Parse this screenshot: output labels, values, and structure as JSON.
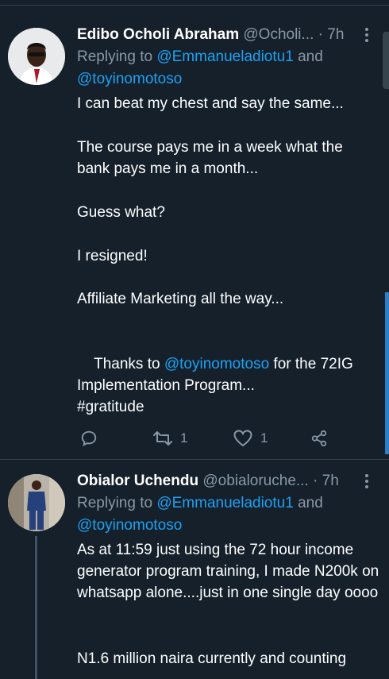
{
  "tweets": [
    {
      "name": "Edibo Ocholi Abraham",
      "handle": "@Ocholi...",
      "dot": "·",
      "time": "7h",
      "replying_prefix": "Replying to ",
      "reply_mention_1": "@Emmanueladiotu1",
      "reply_and": " and",
      "reply_mention_2": "@toyinomotoso",
      "lines": {
        "l1": "I can beat my chest and say the same...",
        "l2": "The course pays me in a week what the bank pays me in a month...",
        "l3": "Guess what?",
        "l4": "I resigned!",
        "l5": "Affiliate Marketing all the way...",
        "l6_pre": "Thanks to ",
        "l6_mention": "@toyinomotoso",
        "l6_post": " for the 72IG Implementation Program...",
        "hashtag": "#gratitude"
      },
      "retweets": "1",
      "likes": "1",
      "icons": [
        "reply-icon",
        "retweet-icon",
        "like-icon",
        "share-icon"
      ]
    },
    {
      "name": "Obialor Uchendu",
      "handle": "@obialoruche...",
      "dot": "·",
      "time": "7h",
      "replying_prefix": "Replying to ",
      "reply_mention_1": "@Emmanueladiotu1",
      "reply_and": " and",
      "reply_mention_2": "@toyinomotoso",
      "lines": {
        "l1": "As at 11:59 just using the 72 hour income generator program training, I made N200k on whatsapp alone....just in one single day oooo",
        "l2": "N1.6 million naira currently and counting"
      }
    }
  ],
  "colors": {
    "background": "#15202b",
    "link": "#1da1f2",
    "muted": "#8899a6",
    "scrollbar": "#2a7fc7"
  }
}
